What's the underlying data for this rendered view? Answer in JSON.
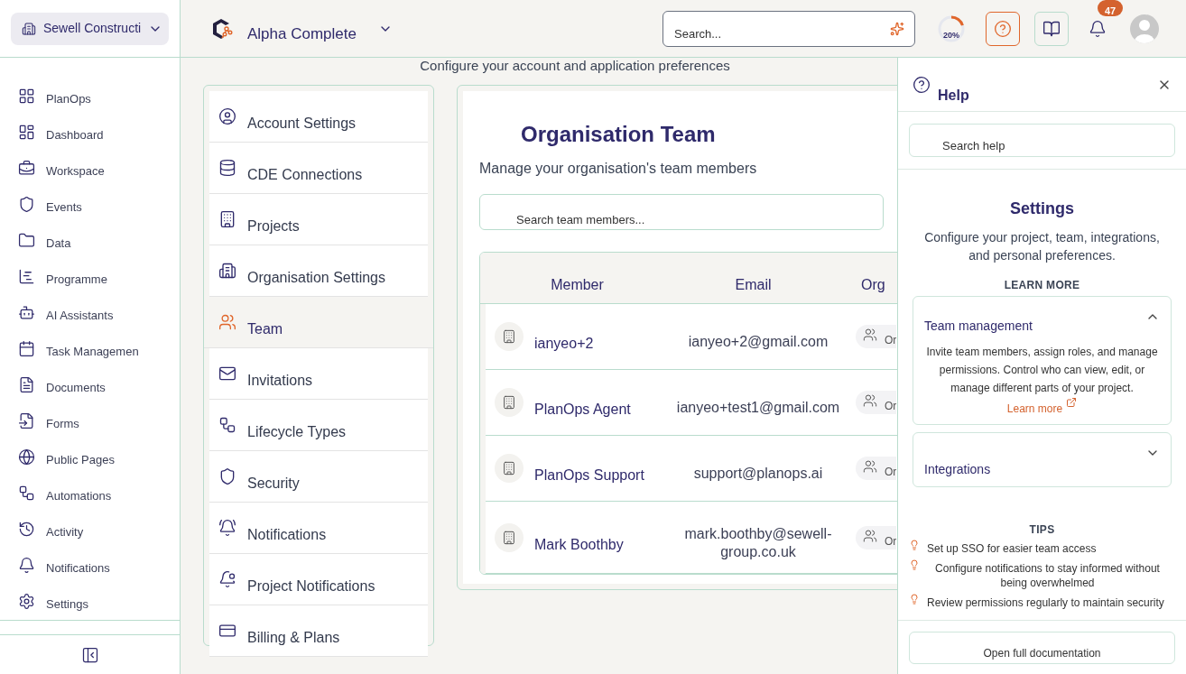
{
  "org_switcher": {
    "label": "Sewell Constructi"
  },
  "project": {
    "name": "Alpha Complete"
  },
  "search": {
    "placeholder": "Search..."
  },
  "progress": {
    "level": 0.2,
    "reading": "20%"
  },
  "notifications": {
    "count": "47"
  },
  "sidebar": {
    "items": [
      {
        "label": "PlanOps"
      },
      {
        "label": "Dashboard"
      },
      {
        "label": "Workspace"
      },
      {
        "label": "Events"
      },
      {
        "label": "Data"
      },
      {
        "label": "Programme"
      },
      {
        "label": "AI Assistants"
      },
      {
        "label": "Task Managemen"
      },
      {
        "label": "Documents"
      },
      {
        "label": "Forms"
      },
      {
        "label": "Public Pages"
      },
      {
        "label": "Automations"
      },
      {
        "label": "Activity"
      },
      {
        "label": "Notifications"
      },
      {
        "label": "Settings"
      }
    ]
  },
  "page": {
    "subtitle": "Configure your account and application preferences"
  },
  "settings_nav": [
    {
      "label": "Account Settings",
      "selected": false
    },
    {
      "label": "CDE Connections",
      "selected": false
    },
    {
      "label": "Projects",
      "selected": false
    },
    {
      "label": "Organisation Settings",
      "selected": false
    },
    {
      "label": "Team",
      "selected": true
    },
    {
      "label": "Invitations",
      "selected": false
    },
    {
      "label": "Lifecycle Types",
      "selected": false
    },
    {
      "label": "Security",
      "selected": false
    },
    {
      "label": "Notifications",
      "selected": false
    },
    {
      "label": "Project Notifications",
      "selected": false
    },
    {
      "label": "Billing & Plans",
      "selected": false
    }
  ],
  "team": {
    "title": "Organisation Team",
    "subtitle": "Manage your organisation's team members",
    "search_placeholder": "Search team members...",
    "columns": [
      "Member",
      "Email",
      "Org"
    ],
    "rows": [
      {
        "member": "ianyeo+2",
        "email": "ianyeo+2@gmail.com",
        "role": "Or"
      },
      {
        "member": "PlanOps Agent",
        "email": "ianyeo+test1@gmail.com",
        "role": "Or"
      },
      {
        "member": "PlanOps Support",
        "email": "support@planops.ai",
        "role": "Or"
      },
      {
        "member": "Mark Boothby",
        "email": "mark.boothby@sewell-group.co.uk",
        "role": "Or"
      }
    ]
  },
  "help": {
    "title": "Help",
    "search_placeholder": "Search help",
    "heading": "Settings",
    "description": "Configure your project, team, integrations, and personal preferences.",
    "learn_more_label": "LEARN MORE",
    "sections": [
      {
        "title": "Team management",
        "expanded": true,
        "body": "Invite team members, assign roles, and manage permissions. Control who can view, edit, or manage different parts of your project.",
        "link": "Learn more"
      },
      {
        "title": "Integrations",
        "expanded": false
      }
    ],
    "tips_label": "TIPS",
    "tips": [
      "Set up SSO for easier team access",
      "Configure notifications to stay informed without being overwhelmed",
      "Review permissions regularly to maintain security"
    ],
    "docs_button": "Open full documentation"
  }
}
